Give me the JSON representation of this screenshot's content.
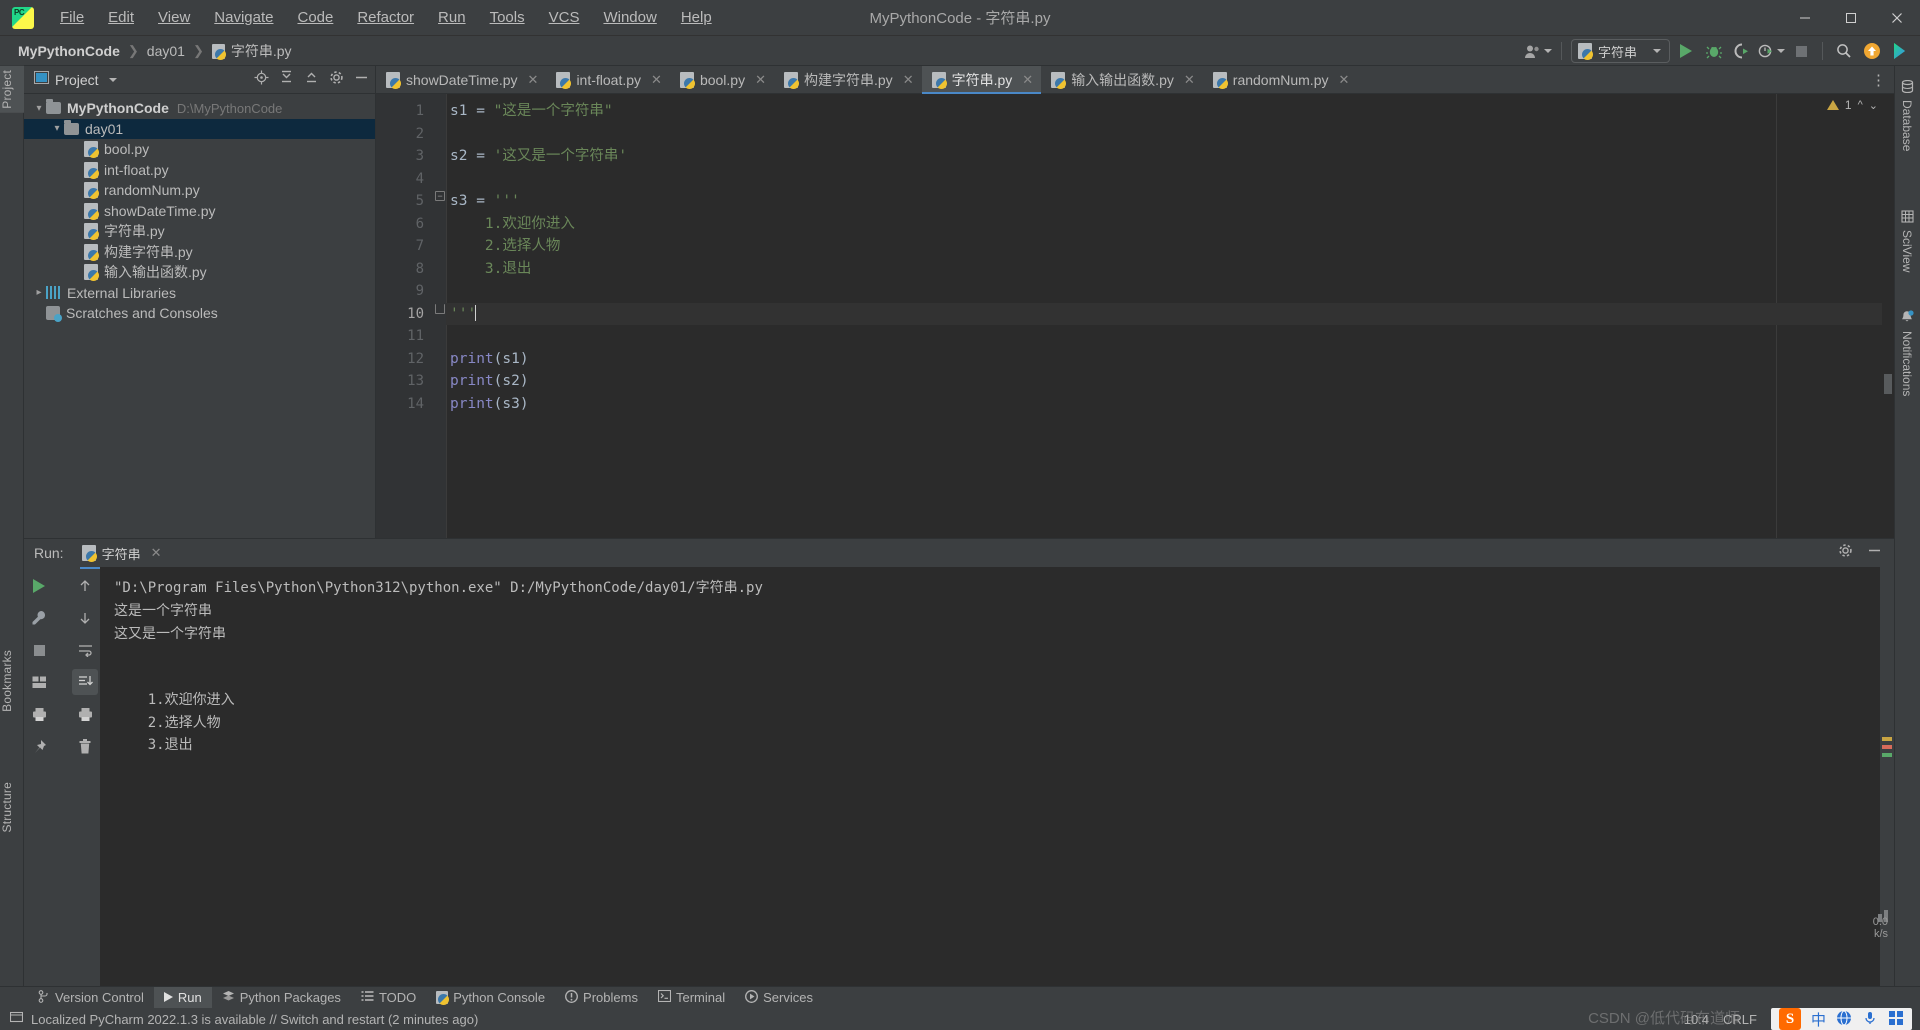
{
  "window": {
    "title": "MyPythonCode - 字符串.py",
    "app_icon": "pycharm-logo-icon",
    "minimize": "–",
    "maximize": "▢",
    "close": "✕"
  },
  "menu": {
    "items": [
      {
        "label": "File"
      },
      {
        "label": "Edit"
      },
      {
        "label": "View"
      },
      {
        "label": "Navigate"
      },
      {
        "label": "Code"
      },
      {
        "label": "Refactor"
      },
      {
        "label": "Run"
      },
      {
        "label": "Tools"
      },
      {
        "label": "VCS"
      },
      {
        "label": "Window"
      },
      {
        "label": "Help"
      }
    ]
  },
  "breadcrumb": {
    "project": "MyPythonCode",
    "folder": "day01",
    "file": "字符串.py",
    "separator": "❯"
  },
  "toolbar": {
    "run_config": "字符串",
    "account_icon": "user-account-icon",
    "run_icon": "run-icon",
    "debug_icon": "debug-icon",
    "coverage_icon": "run-with-coverage-icon",
    "profile_icon": "profiler-icon",
    "stop_icon": "stop-icon",
    "search_icon": "search-everywhere-icon",
    "update_icon": "update-project-icon",
    "plugin_icon": "ide-tools-icon"
  },
  "left_strip": {
    "tabs": [
      {
        "label": "Project",
        "selected": true
      },
      {
        "label": "Bookmarks",
        "selected": false
      },
      {
        "label": "Structure",
        "selected": false
      }
    ]
  },
  "right_strip": {
    "tabs": [
      {
        "label": "Database",
        "icon": "database-icon"
      },
      {
        "label": "SciView",
        "icon": "sciview-icon"
      },
      {
        "label": "Notifications",
        "icon": "bell-icon"
      }
    ]
  },
  "project_panel": {
    "title": "Project",
    "header_icons": [
      "locate-icon",
      "collapse-all-icon",
      "expand-icon",
      "settings-gear-icon",
      "hide-icon"
    ],
    "tree": [
      {
        "label": "MyPythonCode",
        "hint": "D:\\MyPythonCode",
        "type": "folder",
        "depth": 0,
        "arrow": "v",
        "bold": true,
        "selected": false
      },
      {
        "label": "day01",
        "hint": "",
        "type": "folder",
        "depth": 1,
        "arrow": "v",
        "bold": false,
        "selected": true
      },
      {
        "label": "bool.py",
        "hint": "",
        "type": "python",
        "depth": 2,
        "arrow": "",
        "bold": false,
        "selected": false
      },
      {
        "label": "int-float.py",
        "hint": "",
        "type": "python",
        "depth": 2,
        "arrow": "",
        "bold": false,
        "selected": false
      },
      {
        "label": "randomNum.py",
        "hint": "",
        "type": "python",
        "depth": 2,
        "arrow": "",
        "bold": false,
        "selected": false
      },
      {
        "label": "showDateTime.py",
        "hint": "",
        "type": "python",
        "depth": 2,
        "arrow": "",
        "bold": false,
        "selected": false
      },
      {
        "label": "字符串.py",
        "hint": "",
        "type": "python",
        "depth": 2,
        "arrow": "",
        "bold": false,
        "selected": false
      },
      {
        "label": "构建字符串.py",
        "hint": "",
        "type": "python",
        "depth": 2,
        "arrow": "",
        "bold": false,
        "selected": false
      },
      {
        "label": "输入输出函数.py",
        "hint": "",
        "type": "python",
        "depth": 2,
        "arrow": "",
        "bold": false,
        "selected": false
      },
      {
        "label": "External Libraries",
        "hint": "",
        "type": "library",
        "depth": 0,
        "arrow": ">",
        "bold": false,
        "selected": false
      },
      {
        "label": "Scratches and Consoles",
        "hint": "",
        "type": "scratch",
        "depth": 0,
        "arrow": "",
        "bold": false,
        "selected": false
      }
    ]
  },
  "editor_tabs": {
    "tabs": [
      {
        "label": "showDateTime.py",
        "active": false
      },
      {
        "label": "int-float.py",
        "active": false
      },
      {
        "label": "bool.py",
        "active": false
      },
      {
        "label": "构建字符串.py",
        "active": false
      },
      {
        "label": "字符串.py",
        "active": true
      },
      {
        "label": "输入输出函数.py",
        "active": false
      },
      {
        "label": "randomNum.py",
        "active": false
      }
    ],
    "close_glyph": "✕",
    "more_glyph": "⋮"
  },
  "editor": {
    "warning_count": "1",
    "warning_icon": "warning-triangle-icon",
    "up_arrow": "⌃",
    "down_arrow": "⌄",
    "cursor_line": 10,
    "lines": [
      {
        "n": 1,
        "tokens": [
          {
            "t": "s1",
            "c": "var"
          },
          {
            "t": " = ",
            "c": "op"
          },
          {
            "t": "\"这是一个字符串\"",
            "c": "str"
          }
        ],
        "indent": 0
      },
      {
        "n": 2,
        "tokens": [],
        "indent": 0
      },
      {
        "n": 3,
        "tokens": [
          {
            "t": "s2",
            "c": "var"
          },
          {
            "t": " = ",
            "c": "op"
          },
          {
            "t": "'这又是一个字符串'",
            "c": "str"
          }
        ],
        "indent": 0
      },
      {
        "n": 4,
        "tokens": [],
        "indent": 0
      },
      {
        "n": 5,
        "tokens": [
          {
            "t": "s3",
            "c": "var"
          },
          {
            "t": " = ",
            "c": "op"
          },
          {
            "t": "'''",
            "c": "str"
          }
        ],
        "indent": 0,
        "fold": "minus"
      },
      {
        "n": 6,
        "tokens": [
          {
            "t": "    1.欢迎你进入",
            "c": "str"
          }
        ],
        "indent": 0
      },
      {
        "n": 7,
        "tokens": [
          {
            "t": "    2.选择人物",
            "c": "str"
          }
        ],
        "indent": 0
      },
      {
        "n": 8,
        "tokens": [
          {
            "t": "    3.退出",
            "c": "str"
          }
        ],
        "indent": 0
      },
      {
        "n": 9,
        "tokens": [],
        "indent": 0
      },
      {
        "n": 10,
        "tokens": [
          {
            "t": "'''",
            "c": "str"
          }
        ],
        "indent": 0,
        "fold": "end",
        "caret": true
      },
      {
        "n": 11,
        "tokens": [],
        "indent": 0
      },
      {
        "n": 12,
        "tokens": [
          {
            "t": "print",
            "c": "fn"
          },
          {
            "t": "(s1)",
            "c": "paren"
          }
        ],
        "indent": 0
      },
      {
        "n": 13,
        "tokens": [
          {
            "t": "print",
            "c": "fn"
          },
          {
            "t": "(s2)",
            "c": "paren"
          }
        ],
        "indent": 0
      },
      {
        "n": 14,
        "tokens": [
          {
            "t": "print",
            "c": "fn"
          },
          {
            "t": "(s3)",
            "c": "paren"
          }
        ],
        "indent": 0
      }
    ]
  },
  "run_panel": {
    "label": "Run:",
    "tab_name": "字符串",
    "tab_close": "✕",
    "settings_icon": "gear-icon",
    "hide_icon": "minimize-icon",
    "toolbar_left": [
      "rerun-icon",
      "wrench-icon",
      "stop-icon",
      "layout-icon",
      "print-icon",
      "pin-icon"
    ],
    "toolbar_right": [
      "up-icon",
      "down-icon",
      "soft-wrap-icon",
      "scroll-to-end-icon",
      "print-icon",
      "trash-icon"
    ],
    "console": {
      "command": "\"D:\\Program Files\\Python\\Python312\\python.exe\" D:/MyPythonCode/day01/字符串.py",
      "output_lines": [
        "这是一个字符串",
        "这又是一个字符串",
        "",
        "",
        "    1.欢迎你进入",
        "    2.选择人物",
        "    3.退出"
      ]
    }
  },
  "bottom_bar": {
    "items": [
      {
        "label": "Version Control",
        "icon": "branch-icon",
        "active": false
      },
      {
        "label": "Run",
        "icon": "run-icon",
        "active": true
      },
      {
        "label": "Python Packages",
        "icon": "packages-icon",
        "active": false
      },
      {
        "label": "TODO",
        "icon": "todo-icon",
        "active": false
      },
      {
        "label": "Python Console",
        "icon": "python-icon",
        "active": false
      },
      {
        "label": "Problems",
        "icon": "problems-icon",
        "active": false
      },
      {
        "label": "Terminal",
        "icon": "terminal-icon",
        "active": false
      },
      {
        "label": "Services",
        "icon": "services-icon",
        "active": false
      }
    ]
  },
  "status_bar": {
    "message": "Localized PyCharm 2022.1.3 is available // Switch and restart (2 minutes ago)",
    "caret_position": "10:4",
    "line_separator": "CRLF",
    "memory": "0.0",
    "memory_unit": "k/s",
    "extra_value": "0.1",
    "ime": {
      "sogou": "S",
      "mode": "中",
      "icons": [
        "globe-icon",
        "mic-icon",
        "panel-icon"
      ]
    },
    "watermark": "CSDN @低代码布道师"
  },
  "colors": {
    "accent_blue": "#4a88c7",
    "string_green": "#6a8759",
    "keyword_purple": "#8888c6",
    "variable": "#a9b7c6",
    "editor_bg": "#2b2b2b",
    "panel_bg": "#3c3f41",
    "selection_blue": "#0d293e",
    "run_green": "#59a869"
  }
}
